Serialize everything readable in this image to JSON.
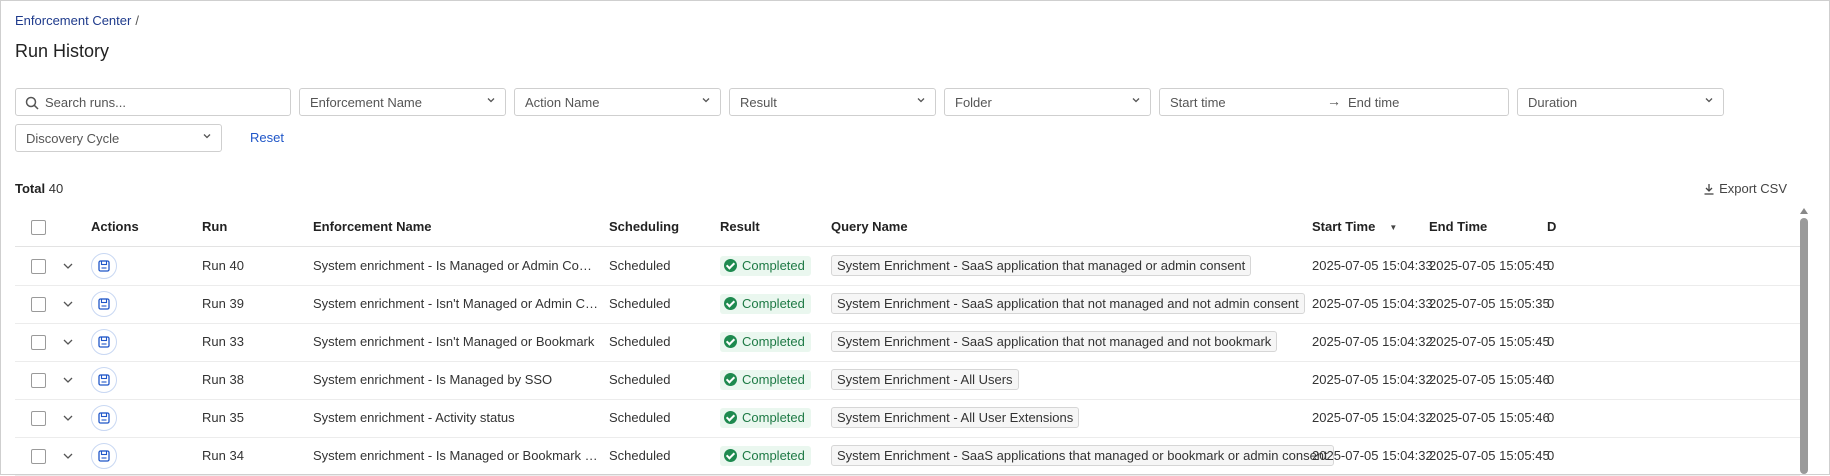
{
  "breadcrumb": {
    "parent": "Enforcement Center",
    "separator": "/"
  },
  "page_title": "Run History",
  "filters": {
    "search_placeholder": "Search runs...",
    "enforcement_name": "Enforcement Name",
    "action_name": "Action Name",
    "result": "Result",
    "folder": "Folder",
    "start_time": "Start time",
    "end_time": "End time",
    "duration": "Duration",
    "discovery_cycle": "Discovery Cycle",
    "reset_label": "Reset"
  },
  "summary": {
    "total_label": "Total",
    "total_count": "40"
  },
  "export_label": "Export CSV",
  "table": {
    "headers": {
      "actions": "Actions",
      "run": "Run",
      "enforcement_name": "Enforcement Name",
      "scheduling": "Scheduling",
      "result": "Result",
      "query_name": "Query Name",
      "start_time": "Start Time",
      "end_time": "End Time",
      "duration_partial": "D"
    },
    "rows": [
      {
        "run": "Run 40",
        "enforcement": "System enrichment - Is Managed or Admin Consent",
        "scheduling": "Scheduled",
        "result": "Completed",
        "query": "System Enrichment - SaaS application that managed or admin consent",
        "start": "2025-07-05 15:04:33",
        "end": "2025-07-05 15:05:45",
        "extra": "0"
      },
      {
        "run": "Run 39",
        "enforcement": "System enrichment - Isn't Managed or Admin Consent",
        "scheduling": "Scheduled",
        "result": "Completed",
        "query": "System Enrichment - SaaS application that not managed and not admin consent",
        "start": "2025-07-05 15:04:33",
        "end": "2025-07-05 15:05:35",
        "extra": "0"
      },
      {
        "run": "Run 33",
        "enforcement": "System enrichment - Isn't Managed or Bookmark",
        "scheduling": "Scheduled",
        "result": "Completed",
        "query": "System Enrichment - SaaS application that not managed and not bookmark",
        "start": "2025-07-05 15:04:32",
        "end": "2025-07-05 15:05:45",
        "extra": "0"
      },
      {
        "run": "Run 38",
        "enforcement": "System enrichment - Is Managed by SSO",
        "scheduling": "Scheduled",
        "result": "Completed",
        "query": "System Enrichment - All Users",
        "start": "2025-07-05 15:04:32",
        "end": "2025-07-05 15:05:46",
        "extra": "0"
      },
      {
        "run": "Run 35",
        "enforcement": "System enrichment - Activity status",
        "scheduling": "Scheduled",
        "result": "Completed",
        "query": "System Enrichment - All User Extensions",
        "start": "2025-07-05 15:04:32",
        "end": "2025-07-05 15:05:46",
        "extra": "0"
      },
      {
        "run": "Run 34",
        "enforcement": "System enrichment - Is Managed or Bookmark or Admin...",
        "scheduling": "Scheduled",
        "result": "Completed",
        "query": "System Enrichment - SaaS applications that managed or bookmark or admin consent",
        "start": "2025-07-05 15:04:32",
        "end": "2025-07-05 15:05:45",
        "extra": "0"
      }
    ]
  },
  "icons": {
    "search": "search-icon",
    "chevron": "chevron-down-icon",
    "arrow": "arrow-right-icon",
    "download": "download-icon",
    "expand": "expand-chevron-icon",
    "action": "save-action-icon",
    "status": "check-circle-icon",
    "sort": "sort-desc-icon"
  },
  "colors": {
    "accent": "#1f56c8",
    "success": "#1e8a4f",
    "link": "#1f3b8c"
  }
}
